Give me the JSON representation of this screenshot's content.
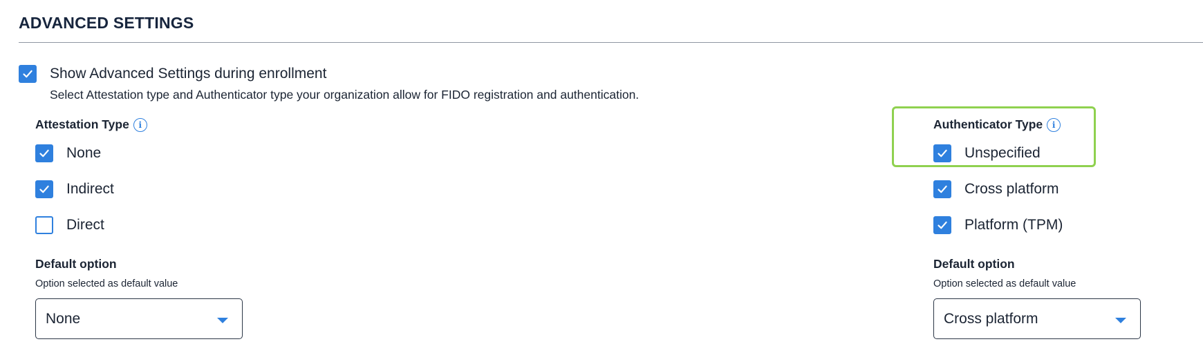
{
  "section": {
    "title": "ADVANCED SETTINGS"
  },
  "show_advanced": {
    "checked": true,
    "label": "Show Advanced Settings during enrollment",
    "description": "Select Attestation type and Authenticator type your organization allow for FIDO registration and authentication."
  },
  "attestation": {
    "title": "Attestation Type",
    "options": [
      {
        "label": "None",
        "checked": true
      },
      {
        "label": "Indirect",
        "checked": true
      },
      {
        "label": "Direct",
        "checked": false
      }
    ],
    "default_title": "Default option",
    "default_subtitle": "Option selected as default value",
    "default_value": "None"
  },
  "authenticator": {
    "title": "Authenticator Type",
    "options": [
      {
        "label": "Unspecified",
        "checked": true
      },
      {
        "label": "Cross platform",
        "checked": true
      },
      {
        "label": "Platform (TPM)",
        "checked": true
      }
    ],
    "default_title": "Default option",
    "default_subtitle": "Option selected as default value",
    "default_value": "Cross platform"
  },
  "colors": {
    "accent": "#2f80de",
    "highlight": "#8fd14f",
    "text": "#1b2433"
  },
  "icons": {
    "check": "check-icon",
    "info": "info-icon",
    "dropdown": "chevron-down-icon"
  }
}
